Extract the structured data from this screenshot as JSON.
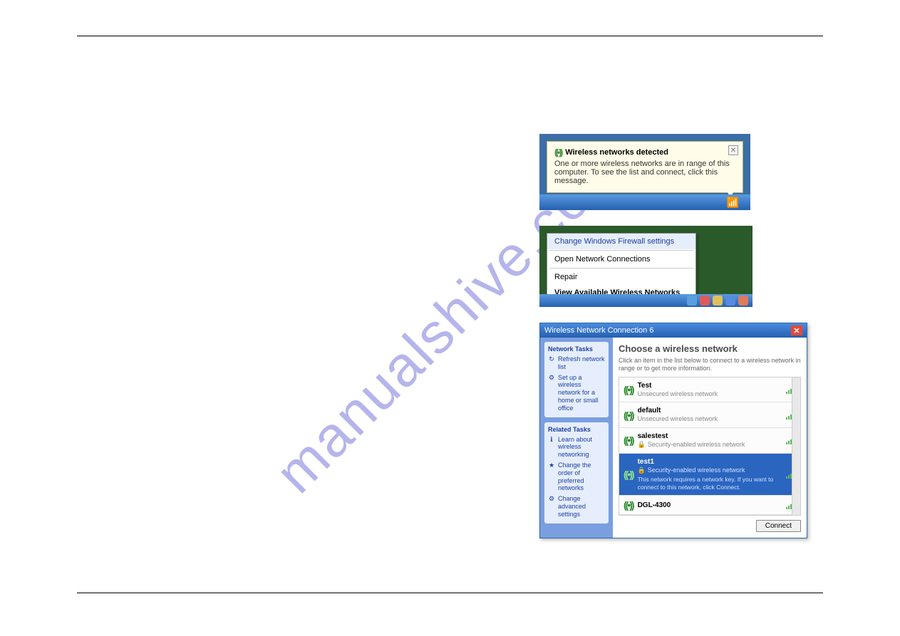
{
  "watermark": "manualshive.com",
  "balloon": {
    "title": "Wireless networks detected",
    "body": "One or more wireless networks are in range of this computer. To see the list and connect, click this message."
  },
  "context_menu": {
    "items": [
      "Change Windows Firewall settings",
      "Open Network Connections",
      "Repair",
      "View Available Wireless Networks"
    ]
  },
  "dialog": {
    "title": "Wireless Network Connection 6",
    "side": {
      "tasks_title": "Network Tasks",
      "refresh": "Refresh network list",
      "setup": "Set up a wireless network for a home or small office",
      "related_title": "Related Tasks",
      "learn": "Learn about wireless networking",
      "order": "Change the order of preferred networks",
      "advanced": "Change advanced settings"
    },
    "main": {
      "title": "Choose a wireless network",
      "subtitle": "Click an item in the list below to connect to a wireless network in range or to get more information.",
      "connect": "Connect"
    },
    "networks": [
      {
        "name": "Test",
        "desc": "Unsecured wireless network",
        "secure": false,
        "selected": false
      },
      {
        "name": "default",
        "desc": "Unsecured wireless network",
        "secure": false,
        "selected": false
      },
      {
        "name": "salestest",
        "desc": "Security-enabled wireless network",
        "secure": true,
        "selected": false
      },
      {
        "name": "test1",
        "desc": "Security-enabled wireless network",
        "secure": true,
        "selected": true,
        "note": "This network requires a network key. If you want to connect to this network, click Connect."
      },
      {
        "name": "DGL-4300",
        "desc": "",
        "secure": false,
        "selected": false
      }
    ]
  }
}
